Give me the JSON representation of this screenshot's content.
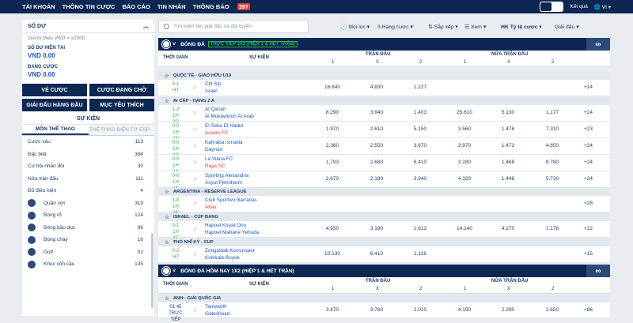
{
  "topnav": {
    "items": [
      "TÀI KHOẢN",
      "THÔNG TIN CƯỢC",
      "BÁO CÁO",
      "TIN NHẮN",
      "THÔNG BÁO"
    ],
    "badge": "397",
    "user": "Kết quả",
    "lang": "VI"
  },
  "balance": {
    "title": "SỐ DƯ",
    "note": "Giá trị theo VND = x1000",
    "avail_label": "SỐ DƯ HIỆN TẠI",
    "avail_value": "VND 0.00",
    "pending_label": "ĐANG CƯỢC",
    "pending_value": "VND 0.00"
  },
  "buttons": [
    "VÉ CƯỢC",
    "CƯỢC ĐANG CHỜ",
    "GIẢI ĐẤU HÀNG ĐẦU",
    "MỤC YÊU THÍCH"
  ],
  "events_label": "SỰ KIỆN",
  "left_tabs": [
    "MÔN THỂ THAO",
    "THỂ THAO ĐIỆN TỬ ESP..."
  ],
  "categories": [
    {
      "name": "Cược xâu",
      "count": "113"
    },
    {
      "name": "Đặc biệt",
      "count": "384"
    },
    {
      "name": "Cơ hội nhân đôi",
      "count": "30"
    },
    {
      "name": "Nửa trận đấu",
      "count": "111"
    },
    {
      "name": "Đủ điều kiện",
      "count": "4"
    }
  ],
  "sports": [
    {
      "name": "Quần vợt",
      "count": "319"
    },
    {
      "name": "Bóng rổ",
      "count": "124"
    },
    {
      "name": "Bóng bầu dục",
      "count": "96"
    },
    {
      "name": "Bóng chày",
      "count": "16"
    },
    {
      "name": "Golf",
      "count": "51"
    },
    {
      "name": "Khúc côn cầu",
      "count": "135"
    }
  ],
  "search": {
    "placeholder": "Tìm kiếm tên giải đấu và đội tuyển"
  },
  "filters": {
    "f1": "Mọi lúc",
    "f2": "3 Hàng cược",
    "f3": "Sắp xếp",
    "f4": "Xem",
    "f5": "HK Tỷ lệ cược",
    "f6": "Giải đấu"
  },
  "section1": {
    "title": "BÓNG ĐÁ",
    "tag": "TRỰC TIẾP 1X2 (HIỆP 1 & HẾT TRẬN)"
  },
  "section2": {
    "title": "BÓNG ĐÁ HÔM NAY 1X2 (HIỆP 1 & HẾT TRẬN)"
  },
  "cols": {
    "time": "THỜI GIAN",
    "event": "SỰ KIỆN",
    "ft": "TRẬN ĐẤU",
    "ht": "NỬA TRẬN ĐẤU",
    "c1": "1",
    "cx": "X",
    "c2": "2"
  },
  "groups": {
    "g1": "QUỐC TẾ - GIAO HỮU U19",
    "g2": "AI CẬP - HẠNG 2 A",
    "g3": "ARGENTINA - RESERVE LEAGUE",
    "g4": "ISRAEL - CÚP BANG",
    "g5": "THỔ NHĨ KỲ - CUP",
    "g6": "ANH - GIẢI QUỐC GIA"
  },
  "matches": [
    {
      "score": "0-1",
      "time": "HT",
      "t1": "CH Síp",
      "t2": "Israel",
      "o1": "16.640",
      "ox": "4.830",
      "o2": "1.227",
      "h1": "",
      "hx": "",
      "h2": "",
      "more": "+14"
    },
    {
      "score": "1-2",
      "time": "1H 25'",
      "t1": "Al Qanah",
      "t2": "Al Mokawloon Al Arab",
      "o1": "8.290",
      "ox": "3.940",
      "o2": "1.403",
      "h1": "25.610",
      "hx": "5.130",
      "h2": "1.177",
      "more": "+24"
    },
    {
      "score": "0-0",
      "time": "1H 24'",
      "t1": "El Seka El Hadid",
      "t2": "Aswan FC",
      "o1": "1.970",
      "ox": "2.610",
      "o2": "5.150",
      "h1": "3.560",
      "hx": "1.476",
      "h2": "7.310",
      "more": "+23"
    },
    {
      "score": "0-0",
      "time": "1H 23'",
      "t1": "Kahraba Ismailia",
      "t2": "Dayrout",
      "o1": "2.360",
      "ox": "2.550",
      "o2": "3.670",
      "h1": "3.970",
      "hx": "1.473",
      "h2": "4.850",
      "more": "+24"
    },
    {
      "score": "0-0",
      "time": "1H 24'",
      "t1": "La Viena FC",
      "t2": "Raya SC",
      "o1": "1.793",
      "ox": "2.680",
      "o2": "6.410",
      "h1": "3.280",
      "hx": "1.468",
      "h2": "8.780",
      "more": "+24"
    },
    {
      "score": "0-0",
      "time": "1H 24'",
      "t1": "Sporting Alexandria",
      "t2": "Asyut Petroleum",
      "o1": "2.670",
      "ox": "2.180",
      "o2": "3.940",
      "h1": "4.320",
      "hx": "1.448",
      "h2": "5.730",
      "more": "+24"
    },
    {
      "score": "1-0",
      "time": "1H 28'",
      "t1": "Club Sportivo Barracas",
      "t2": "Atlas",
      "o1": "",
      "ox": "",
      "o2": "",
      "h1": "",
      "hx": "",
      "h2": "",
      "more": "+28"
    },
    {
      "score": "0-1",
      "time": "1H 27'",
      "t1": "Hapoel Kiryat Ono",
      "t2": "Hapoel Mahane Yehuda",
      "o1": "4.550",
      "ox": "3.190",
      "o2": "1.613",
      "h1": "14.140",
      "hx": "4.270",
      "h2": "1.178",
      "more": "+22"
    },
    {
      "score": "0-2",
      "time": "HT",
      "t1": "Zonguldak Komurspor",
      "t2": "Kirikkale Buyuk",
      "o1": "10.130",
      "ox": "6.410",
      "o2": "1.118",
      "h1": "",
      "hx": "",
      "h2": "",
      "more": "+15"
    },
    {
      "score": "01:45",
      "time": "TRỰC TIẾP",
      "t1": "Tamworth",
      "t2": "Gateshead",
      "o1": "3.470",
      "ox": "3.760",
      "o2": "2.010",
      "h1": "4.150",
      "hx": "2.290",
      "h2": "2.650",
      "more": "+86"
    }
  ]
}
